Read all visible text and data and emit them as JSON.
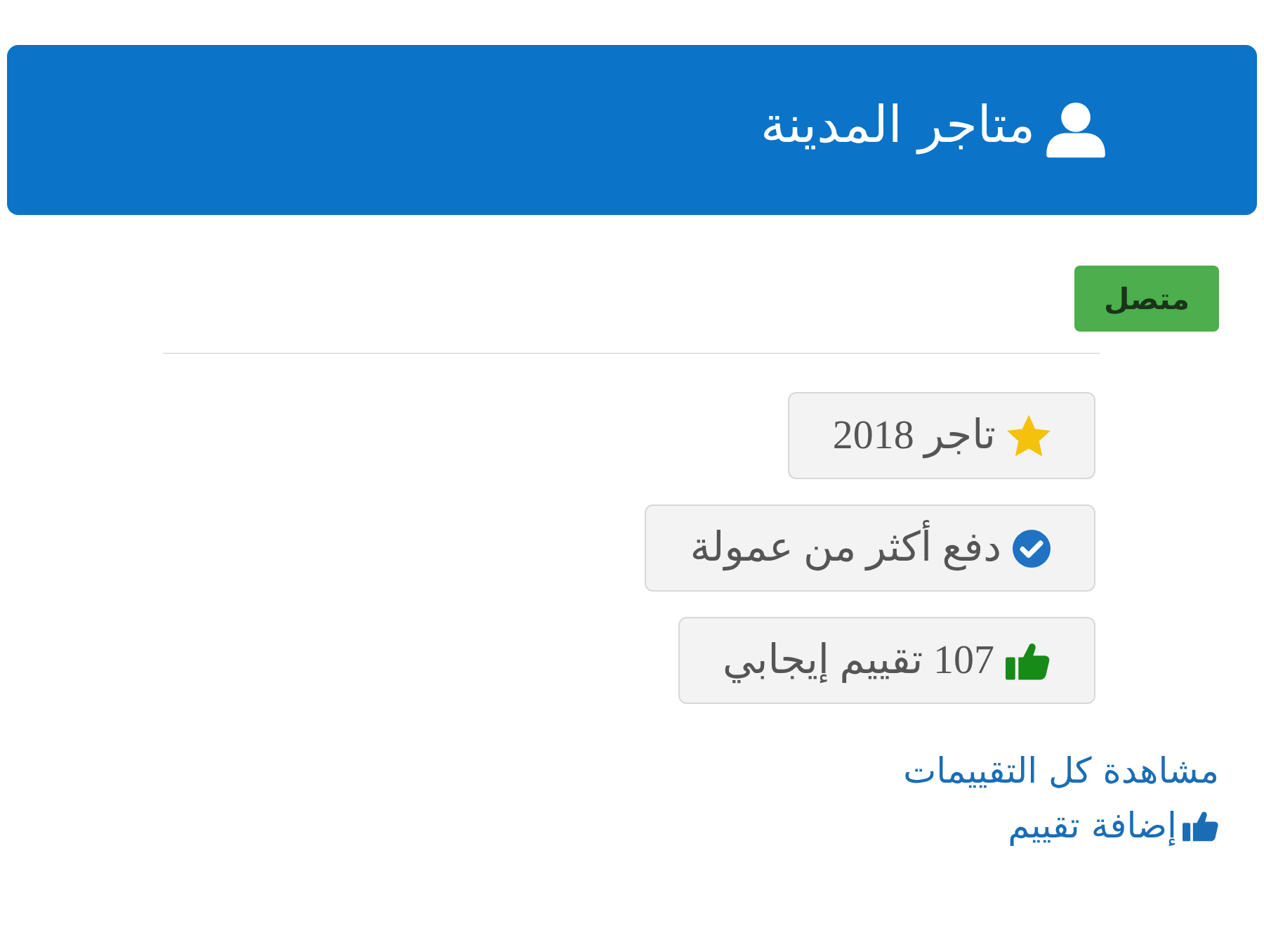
{
  "header": {
    "title": "متاجر المدينة"
  },
  "status_badge": {
    "label": "متصل"
  },
  "badges": [
    {
      "kind": "star",
      "label": "تاجر 2018"
    },
    {
      "kind": "verified",
      "label": "دفع أكثر من عمولة"
    },
    {
      "kind": "thumbs-up",
      "label": "107 تقييم إيجابي"
    }
  ],
  "links": [
    {
      "kind": "plain",
      "label": "مشاهدة كل التقييمات"
    },
    {
      "kind": "thumbs-up",
      "label": "إضافة تقييم"
    }
  ]
}
